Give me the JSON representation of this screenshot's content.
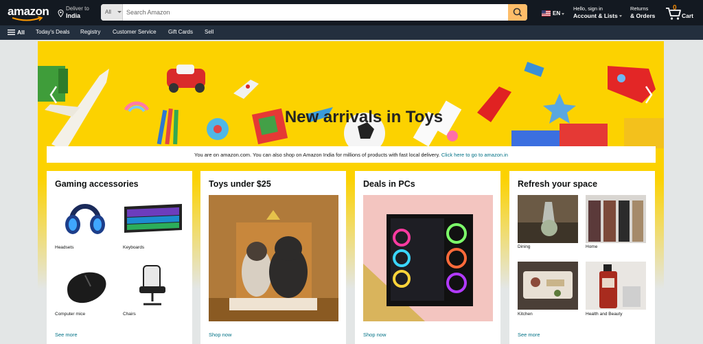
{
  "header": {
    "logo": "amazon",
    "deliver_line1": "Deliver to",
    "deliver_line2": "India",
    "search_category": "All",
    "search_placeholder": "Search Amazon",
    "language": "EN",
    "account_line1": "Hello, sign in",
    "account_line2": "Account & Lists",
    "orders_line1": "Returns",
    "orders_line2": "& Orders",
    "cart_count": "0",
    "cart_label": "Cart",
    "icons": [
      "location-pin-icon",
      "search-icon",
      "us-flag-icon",
      "cart-icon",
      "menu-icon"
    ]
  },
  "subnav": {
    "all": "All",
    "items": [
      "Today's Deals",
      "Registry",
      "Customer Service",
      "Gift Cards",
      "Sell"
    ]
  },
  "hero": {
    "title": "New arrivals in Toys",
    "colors": {
      "background": "#fcd200"
    }
  },
  "notice": {
    "text": "You are on amazon.com. You can also shop on Amazon India for millions of products with fast local delivery.",
    "link": "Click here to go to amazon.in"
  },
  "cards": [
    {
      "title": "Gaming accessories",
      "items": [
        "Headsets",
        "Keyboards",
        "Computer mice",
        "Chairs"
      ],
      "cta": "See more"
    },
    {
      "title": "Toys under $25",
      "cta": "Shop now"
    },
    {
      "title": "Deals in PCs",
      "cta": "Shop now"
    },
    {
      "title": "Refresh your space",
      "items": [
        "Dining",
        "Home",
        "Kitchen",
        "Health and Beauty"
      ],
      "cta": "See more"
    }
  ],
  "colors": {
    "nav_top": "#131921",
    "nav_sub": "#232f3e",
    "search_button": "#febd69",
    "link": "#007185",
    "cart_count": "#f08804"
  }
}
